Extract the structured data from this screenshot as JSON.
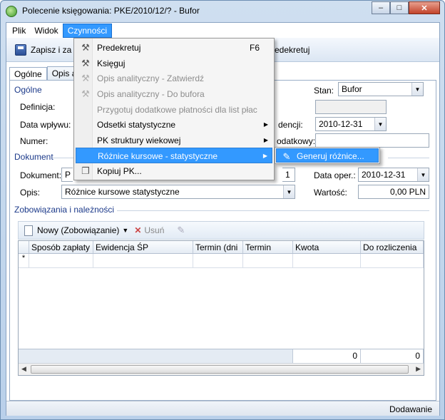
{
  "window": {
    "title": "Polecenie księgowania: PKE/2010/12/? - Bufor",
    "minimize": "–",
    "maximize": "□",
    "close": "✕"
  },
  "menubar": {
    "items": [
      "Plik",
      "Widok",
      "Czynności"
    ]
  },
  "toolbar": {
    "save_label": "Zapisz i za",
    "right_label": "redekretuj"
  },
  "tabs": [
    "Ogólne",
    "Opis an"
  ],
  "general": {
    "section_title": "Ogólne",
    "definicja_label": "Definicja:",
    "data_wplywu_label": "Data wpływu:",
    "numer_label": "Numer:",
    "stan_label": "Stan:",
    "stan_value": "Bufor",
    "ewidencji_label": "dencji:",
    "ewidencji_value": "2010-12-31",
    "dodatkowy_label": "odatkowy:"
  },
  "document": {
    "section_title": "Dokument",
    "dokument_label": "Dokument:",
    "dokument_value_start": "P",
    "dokument_value_end": "1",
    "data_oper_label": "Data oper.:",
    "data_oper_value": "2010-12-31",
    "opis_label": "Opis:",
    "opis_value": "Różnice kursowe statystyczne",
    "wartosc_label": "Wartość:",
    "wartosc_value": "0,00 PLN"
  },
  "obligations": {
    "section_title": "Zobowiązania i należności",
    "new_button": "Nowy (Zobowiązanie)",
    "delete_button": "Usuń",
    "columns": [
      "Sposób zapłaty",
      "Ewidencja ŚP",
      "Termin (dni",
      "Termin",
      "Kwota",
      "Do rozliczenia"
    ],
    "new_row_marker": "*",
    "footer_kwota": "0",
    "footer_do_rozliczenia": "0"
  },
  "status": {
    "mode": "Dodawanie"
  },
  "context_menu": {
    "items": [
      {
        "label": "Predekretuj",
        "shortcut": "F6",
        "icon": "hammer-icon",
        "disabled": false
      },
      {
        "label": "Księguj",
        "shortcut": "",
        "icon": "hammer-icon",
        "disabled": false
      },
      {
        "label": "Opis analityczny - Zatwierdź",
        "shortcut": "",
        "icon": "hammer-icon",
        "disabled": true
      },
      {
        "label": "Opis analityczny - Do bufora",
        "shortcut": "",
        "icon": "hammer-icon",
        "disabled": true
      },
      {
        "label": "Przygotuj dodatkowe płatności dla list płac",
        "shortcut": "",
        "icon": "",
        "disabled": true
      },
      {
        "label": "Odsetki statystyczne",
        "shortcut": "",
        "icon": "",
        "disabled": false
      },
      {
        "label": "PK struktury wiekowej",
        "shortcut": "",
        "icon": "",
        "disabled": false
      },
      {
        "label": "Różnice kursowe - statystyczne",
        "shortcut": "",
        "icon": "",
        "disabled": false
      },
      {
        "label": "Kopiuj PK...",
        "shortcut": "",
        "icon": "copy-icon",
        "disabled": false
      }
    ],
    "submenu_item": "Generuj różnice..."
  }
}
